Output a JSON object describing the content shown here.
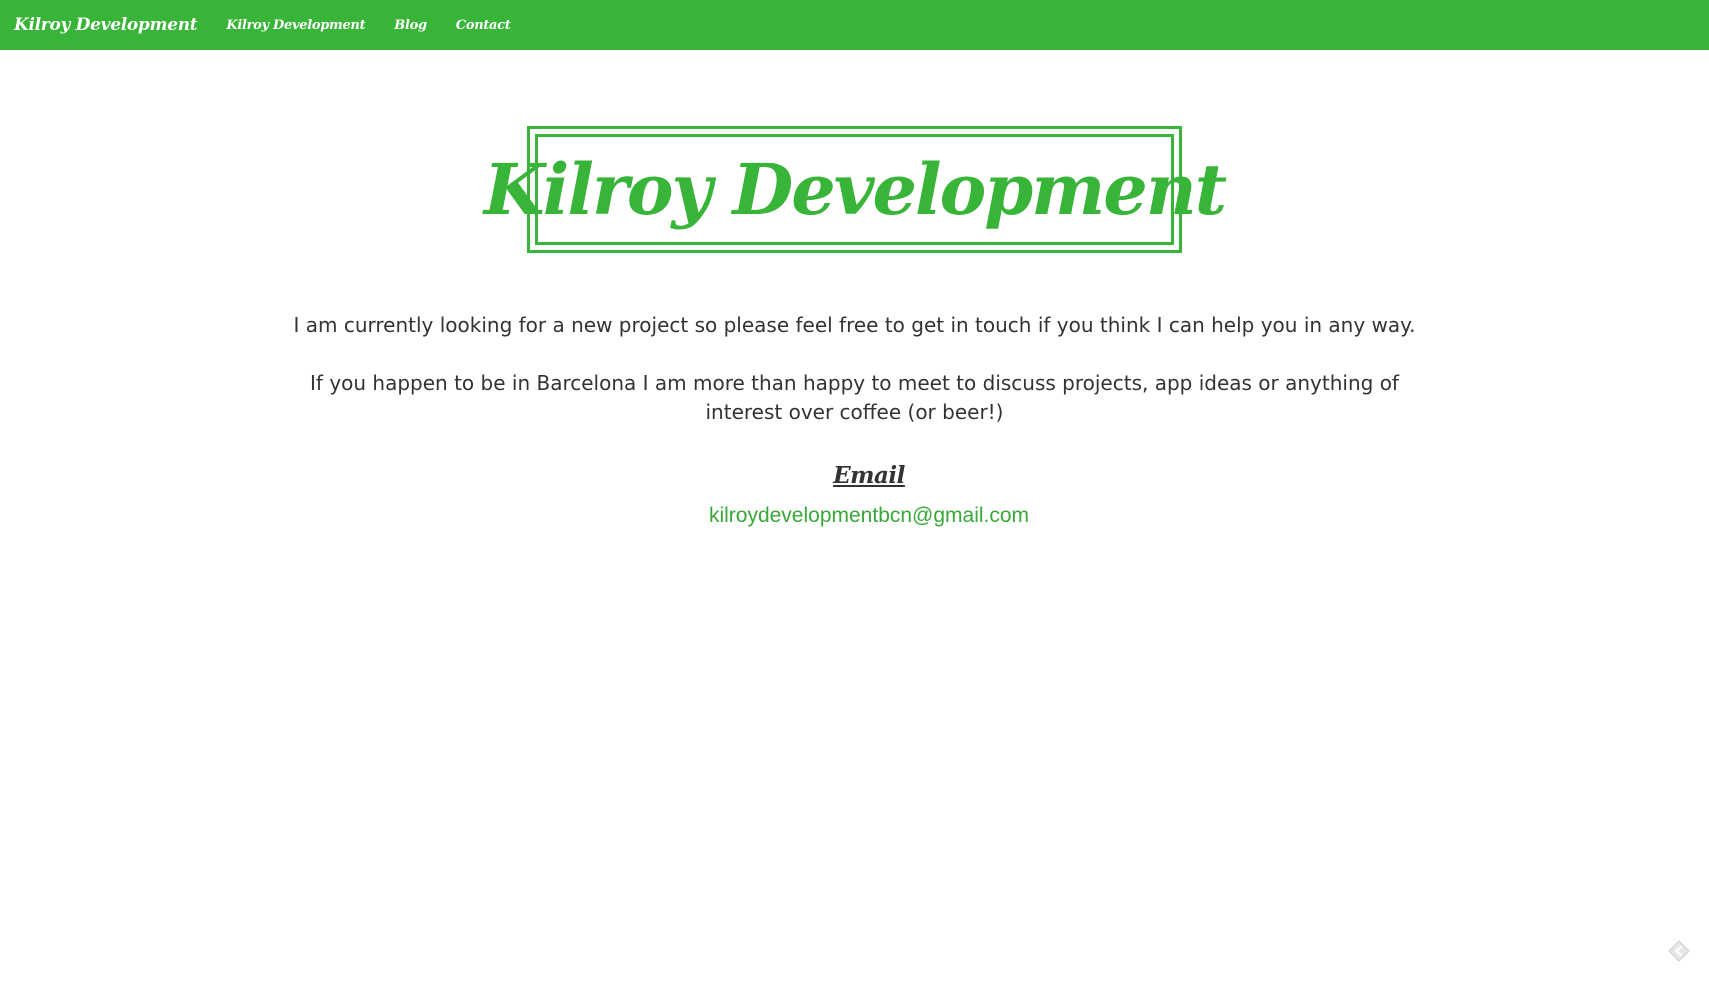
{
  "colors": {
    "accent": "#38b538",
    "text": "#333333",
    "link": "#38a838",
    "background": "#ffffff"
  },
  "navbar": {
    "brand": "Kilroy Development",
    "links": [
      "Kilroy Development",
      "Blog",
      "Contact"
    ]
  },
  "logo": {
    "text": "Kilroy Development"
  },
  "content": {
    "paragraph_1": "I am currently looking for a new project so please feel free to get in touch if you think I can help you in any way.",
    "paragraph_2": "If you happen to be in Barcelona I am more than happy to meet to discuss projects, app ideas or anything of interest over coffee (or beer!)"
  },
  "contact": {
    "heading": "Email",
    "email": "kilroydevelopmentbcn@gmail.com"
  },
  "icons": {
    "corner": "back-arrow-icon"
  }
}
